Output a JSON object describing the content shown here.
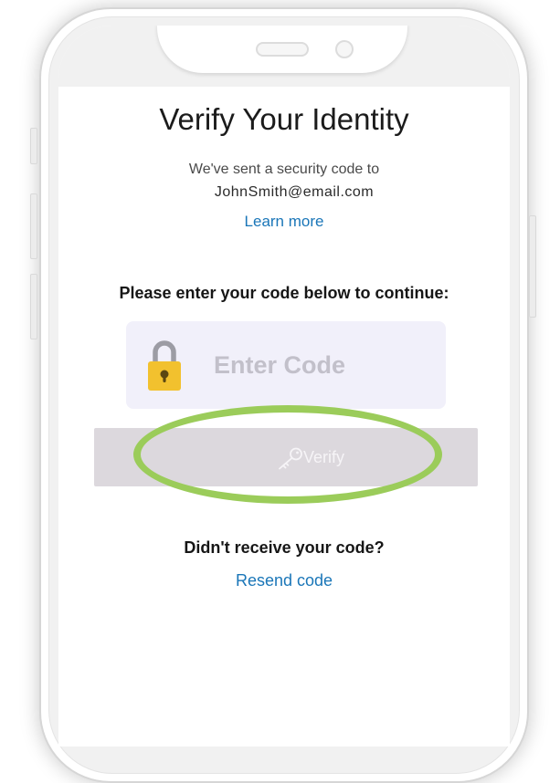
{
  "screen": {
    "title": "Verify Your Identity",
    "sent_message": "We've sent a security code to",
    "email": "JohnSmith@email.com",
    "learn_more": "Learn more",
    "instruction": "Please enter your code below to continue:",
    "code_input": {
      "value": "",
      "placeholder": "Enter Code",
      "icon": "lock-icon"
    },
    "verify_button": {
      "label": "Verify",
      "icon": "key-icon",
      "enabled": false
    },
    "didnt_receive": "Didn't receive your code?",
    "resend": "Resend code"
  },
  "annotation": {
    "type": "ellipse-highlight",
    "target": "verify-button",
    "color": "#9bcc5a"
  },
  "colors": {
    "link": "#1a76b8",
    "input_background": "#f1f0fa",
    "button_disabled": "#dcd8dd",
    "lock_body": "#f2c12e"
  }
}
